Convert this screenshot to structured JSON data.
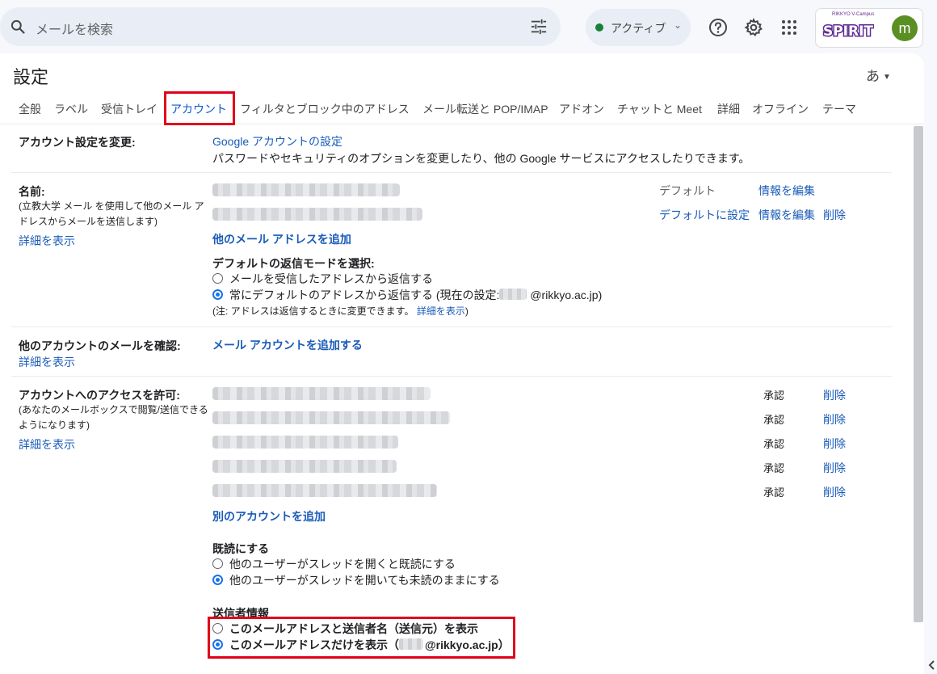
{
  "search": {
    "placeholder": "メールを検索"
  },
  "status": {
    "label": "アクティブ"
  },
  "brand": {
    "top_text": "RIKKYO V-Campus",
    "logo_text": "SPIRIT",
    "avatar_letter": "m"
  },
  "page": {
    "title": "設定",
    "input_tool_label": "あ"
  },
  "tabs": [
    {
      "label": "全般"
    },
    {
      "label": "ラベル"
    },
    {
      "label": "受信トレイ"
    },
    {
      "label": "アカウント",
      "active": true
    },
    {
      "label": "フィルタとブロック中のアドレス"
    },
    {
      "label": "メール転送と POP/IMAP"
    },
    {
      "label": "アドオン"
    },
    {
      "label": "チャットと Meet"
    },
    {
      "label": "詳細"
    },
    {
      "label": "オフライン"
    },
    {
      "label": "テーマ"
    }
  ],
  "account_settings": {
    "label": "アカウント設定を変更:",
    "link": "Google アカウントの設定",
    "description": "パスワードやセキュリティのオプションを変更したり、他の Google サービスにアクセスしたりできます。"
  },
  "name": {
    "label": "名前:",
    "note_line1": "(立教大学 メール を使用して他のメール ア",
    "note_line2": "ドレスからメールを送信します)",
    "details_link": "詳細を表示",
    "row1_status": "デフォルト",
    "row1_edit": "情報を編集",
    "row2_set_default": "デフォルトに設定",
    "row2_edit": "情報を編集",
    "row2_delete": "削除",
    "add_address": "他のメール アドレスを追加",
    "reply_mode_title": "デフォルトの返信モードを選択:",
    "reply_option1": "メールを受信したアドレスから返信する",
    "reply_option2": "常にデフォルトのアドレスから返信する (現在の設定: ",
    "reply_option2_domain": "@rikkyo.ac.jp)",
    "reply_selected": 2,
    "reply_note": "(注: アドレスは返信するときに変更できます。",
    "reply_note_link": "詳細を表示",
    "reply_note_end": ")"
  },
  "check_mail": {
    "label": "他のアカウントのメールを確認:",
    "details_link": "詳細を表示",
    "add_account": "メール アカウントを追加する"
  },
  "grant_access": {
    "label": "アカウントへのアクセスを許可:",
    "note_line1": "(あなたのメールボックスで閲覧/送信できる",
    "note_line2": "ようになります)",
    "details_link": "詳細を表示",
    "rows": [
      {
        "status": "承認",
        "delete": "削除"
      },
      {
        "status": "承認",
        "delete": "削除"
      },
      {
        "status": "承認",
        "delete": "削除"
      },
      {
        "status": "承認",
        "delete": "削除"
      },
      {
        "status": "承認",
        "delete": "削除"
      }
    ],
    "add_another": "別のアカウントを追加",
    "mark_read_title": "既読にする",
    "mark_read_option1": "他のユーザーがスレッドを開くと既読にする",
    "mark_read_option2": "他のユーザーがスレッドを開いても未読のままにする",
    "mark_read_selected": 2,
    "sender_info_title": "送信者情報",
    "sender_option1": "このメールアドレスと送信者名（送信元）を表示",
    "sender_option2": "このメールアドレスだけを表示（",
    "sender_option2_domain": "@rikkyo.ac.jp）",
    "sender_selected": 2
  },
  "colors": {
    "accent": "#0b57d0",
    "link": "#1a5bb8",
    "highlight_box": "#e0001b",
    "status_dot": "#188038"
  },
  "icons": [
    "search-icon",
    "tune-icon",
    "help-icon",
    "gear-icon",
    "apps-icon",
    "chevron-left-icon"
  ]
}
